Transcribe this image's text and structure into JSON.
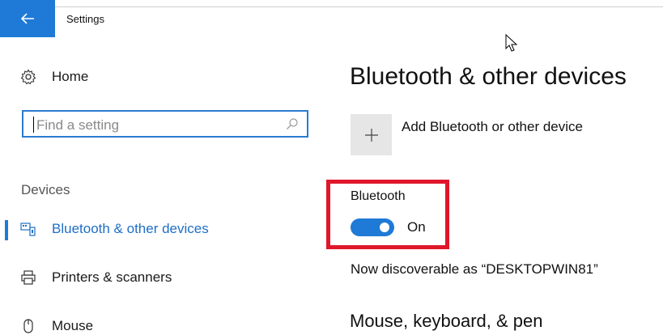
{
  "app": {
    "title": "Settings"
  },
  "sidebar": {
    "home_label": "Home",
    "search_placeholder": "Find a setting",
    "section_label": "Devices",
    "items": [
      {
        "label": "Bluetooth & other devices",
        "icon": "bluetooth-devices-icon",
        "selected": true
      },
      {
        "label": "Printers & scanners",
        "icon": "printer-icon"
      },
      {
        "label": "Mouse",
        "icon": "mouse-icon"
      }
    ]
  },
  "main": {
    "title": "Bluetooth & other devices",
    "add_device_label": "Add Bluetooth or other device",
    "bluetooth_label": "Bluetooth",
    "toggle_state": "On",
    "discoverable_text": "Now discoverable as “DESKTOPWIN81”",
    "next_section": "Mouse, keyboard, & pen"
  },
  "colors": {
    "accent": "#1e7ad6",
    "highlight": "#e0162b"
  }
}
